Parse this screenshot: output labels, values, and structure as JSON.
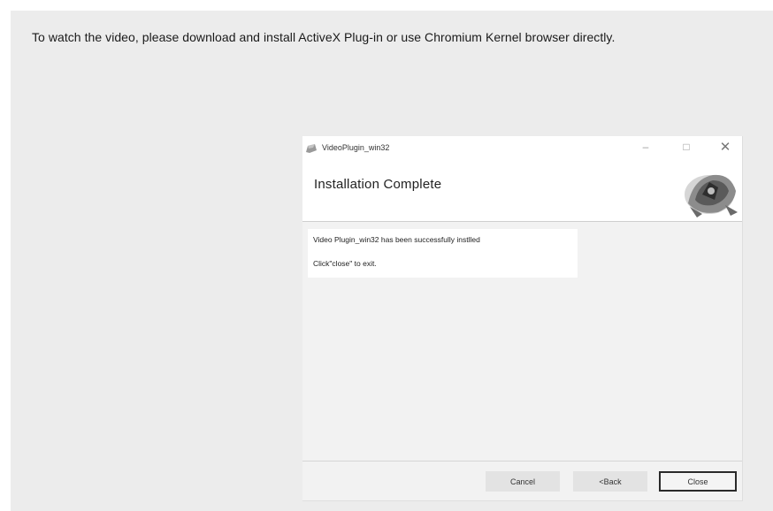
{
  "notice": {
    "text": "To watch the video, please download and install ActiveX Plug-in or use Chromium Kernel browser directly."
  },
  "dialog": {
    "title": "VideoPlugin_win32",
    "heading": "Installation Complete",
    "window_controls": {
      "minimize": "–",
      "maximize": "□",
      "close": "✕"
    },
    "icons": {
      "app": "installer-app-icon",
      "header": "installer-wizard-graphic"
    },
    "messages": {
      "success": "Video Plugin_win32 has been successfully instlled",
      "exit_hint": "Click\"close\" to exit."
    },
    "buttons": {
      "cancel": "Cancel",
      "back": "<Back",
      "close": "Close"
    }
  }
}
